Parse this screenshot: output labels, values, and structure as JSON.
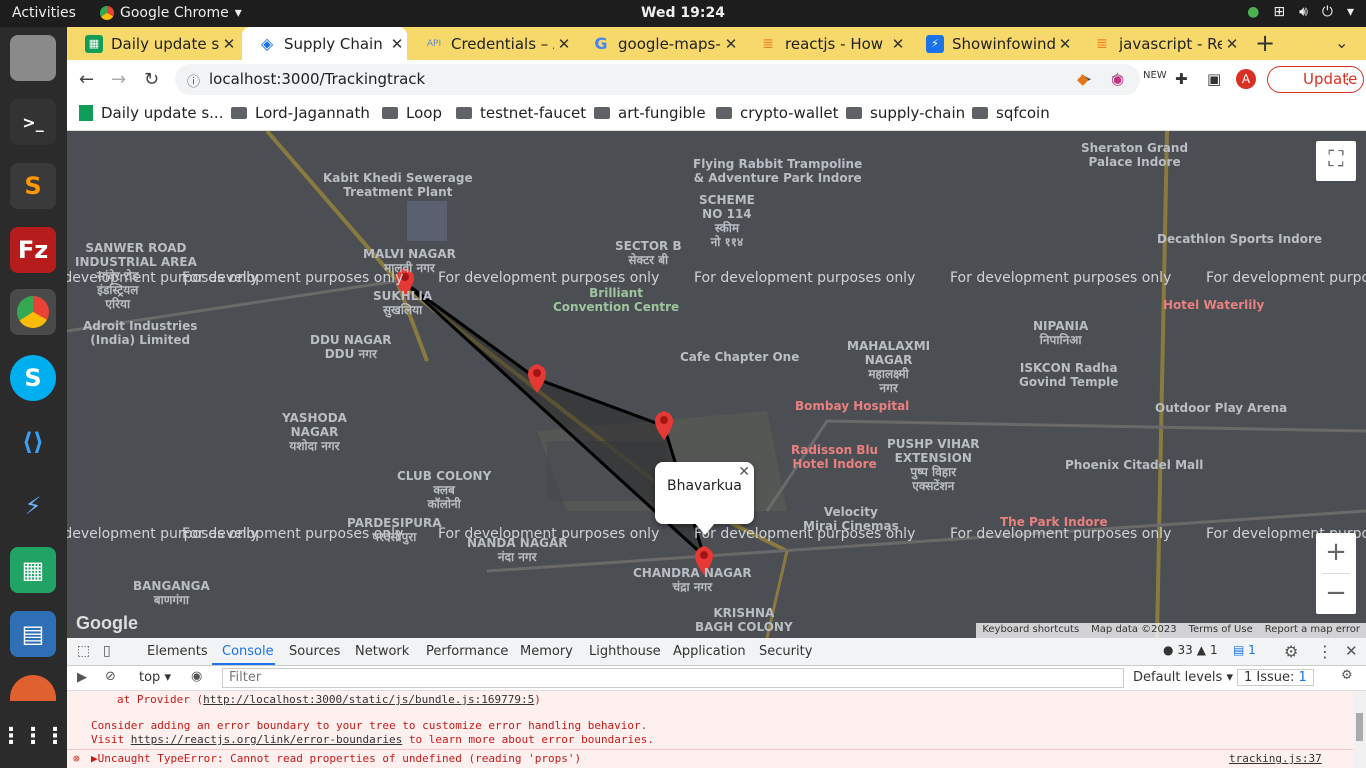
{
  "system": {
    "activities": "Activities",
    "app": "Google Chrome",
    "clock": "Wed 19:24"
  },
  "tabs": [
    {
      "title": "Daily update sh",
      "color": "#0f9d58"
    },
    {
      "title": "Supply Chain",
      "color": "#1a73e8"
    },
    {
      "title": "Credentials – A",
      "color": "#5f8bd6"
    },
    {
      "title": "google-maps-r",
      "color": "#4285f4"
    },
    {
      "title": "reactjs - How to",
      "color": "#f48024"
    },
    {
      "title": "Showinfowind",
      "color": "#1a73e8"
    },
    {
      "title": "javascript - Rea",
      "color": "#f48024"
    }
  ],
  "toolbar": {
    "url": "localhost:3000/Trackingtrack",
    "update_label": "Update",
    "avatar": "A"
  },
  "bookmarks": [
    "Daily update s...",
    "Lord-Jagannath",
    "Loop",
    "testnet-faucet",
    "art-fungible",
    "crypto-wallet",
    "supply-chain",
    "sqfcoin"
  ],
  "map": {
    "watermark": "For development purposes only",
    "labels": [
      {
        "text": "SANWER ROAD\nINDUSTRIAL AREA"
      },
      {
        "text": "सांवेर रोड\nइंडस्ट्रियल\nएरिया"
      },
      {
        "text": "MALVI NAGAR\nमालवी नगर"
      },
      {
        "text": "SUKHLIA\nसुखलिया"
      },
      {
        "text": "DDU NAGAR\nDDU नगर"
      },
      {
        "text": "YASHODA\nNAGAR\nयशोदा नगर"
      },
      {
        "text": "CLUB COLONY\nक्लब\nकॉलोनी"
      },
      {
        "text": "PARDESIPURA\nपरदेसीपुरा"
      },
      {
        "text": "NANDA NAGAR\nनंदा नगर"
      },
      {
        "text": "BANGANGA\nबाणगंगा"
      },
      {
        "text": "SCHEME\nNO 114\nस्कीम\nनो ११४"
      },
      {
        "text": "SECTOR B\nसेक्टर बी"
      },
      {
        "text": "MAHALAXMI\nNAGAR\nमहालक्ष्मी\nनगर"
      },
      {
        "text": "NIPANIA\nनिपानिआ"
      },
      {
        "text": "PUSHP VIHAR\nEXTENSION\nपुष्प विहार\nएक्सटेंशन"
      },
      {
        "text": "Bombay Hospital"
      },
      {
        "text": "Radisson Blu\nHotel Indore"
      },
      {
        "text": "Phoenix Citadel Mall"
      },
      {
        "text": "ISKCON Radha\nGovind Temple"
      },
      {
        "text": "Outdoor Play Arena"
      },
      {
        "text": "Decathlon Sports Indore"
      },
      {
        "text": "Hotel Waterlily"
      },
      {
        "text": "Sheraton Grand\nPalace Indore"
      },
      {
        "text": "Flying Rabbit Trampoline\n& Adventure Park Indore"
      },
      {
        "text": "Brilliant\nConvention Centre"
      },
      {
        "text": "Cafe Chapter One"
      },
      {
        "text": "CHANDRA NAGAR\nचंद्रा नगर"
      },
      {
        "text": "KRISHNA\nBAGH COLONY"
      },
      {
        "text": "Velocity\nMirai Cinemas"
      },
      {
        "text": "The Park Indore"
      },
      {
        "text": "Adroit Industries\n(India) Limited"
      },
      {
        "text": "Kabit Khedi Sewerage\nTreatment Plant"
      }
    ],
    "info_window": "Bhavarkua",
    "footer": [
      "Keyboard shortcuts",
      "Map data ©2023",
      "Terms of Use",
      "Report a map error"
    ],
    "logo": "Google"
  },
  "devtools": {
    "tabs": [
      "Elements",
      "Console",
      "Sources",
      "Network",
      "Performance",
      "Memory",
      "Lighthouse",
      "Application",
      "Security"
    ],
    "counts": {
      "errors": "33",
      "warnings": "1",
      "messages": "1"
    },
    "context": "top",
    "filter_placeholder": "Filter",
    "levels": "Default levels",
    "issues": "1 Issue:",
    "issues_count": "1",
    "log": [
      {
        "prefix": "at Provider (",
        "link": "http://localhost:3000/static/js/bundle.js:169779:5",
        "suffix": ")"
      },
      {
        "text": "Consider adding an error boundary to your tree to customize error handling behavior."
      },
      {
        "prefix": "Visit ",
        "link": "https://reactjs.org/link/error-boundaries",
        "suffix": " to learn more about error boundaries."
      },
      {
        "text": "▶Uncaught TypeError: Cannot read properties of undefined (reading 'props')",
        "source": "tracking.js:37"
      }
    ]
  }
}
